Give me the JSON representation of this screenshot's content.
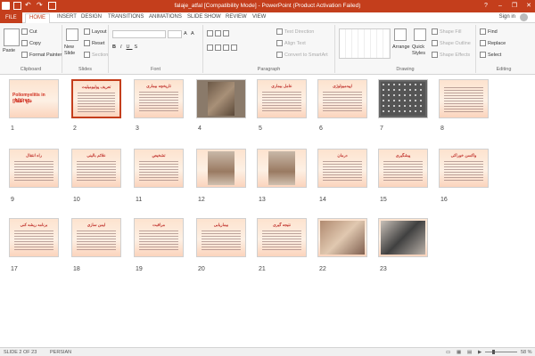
{
  "titlebar": {
    "title": "falaje_atfal [Compatibility Mode] - PowerPoint (Product Activation Failed)",
    "help": "?",
    "min": "–",
    "restore": "❐",
    "close": "✕"
  },
  "tabs": {
    "file": "FILE",
    "home": "HOME",
    "insert": "INSERT",
    "design": "DESIGN",
    "transitions": "TRANSITIONS",
    "animations": "ANIMATIONS",
    "slideshow": "SLIDE SHOW",
    "review": "REVIEW",
    "view": "VIEW",
    "signin": "Sign in"
  },
  "ribbon": {
    "clipboard": {
      "paste": "Paste",
      "cut": "Cut",
      "copy": "Copy",
      "format_painter": "Format Painter",
      "label": "Clipboard"
    },
    "slides": {
      "new_slide": "New Slide",
      "layout": "Layout",
      "reset": "Reset",
      "section": "Section",
      "label": "Slides"
    },
    "font": {
      "label": "Font"
    },
    "paragraph": {
      "text_direction": "Text Direction",
      "align_text": "Align Text",
      "convert_smartart": "Convert to SmartArt",
      "label": "Paragraph"
    },
    "drawing": {
      "arrange": "Arrange",
      "quick_styles": "Quick Styles",
      "shape_fill": "Shape Fill",
      "shape_outline": "Shape Outline",
      "shape_effects": "Shape Effects",
      "label": "Drawing"
    },
    "editing": {
      "find": "Find",
      "replace": "Replace",
      "select": "Select",
      "label": "Editing"
    }
  },
  "slides": [
    {
      "num": "1",
      "title": "Poliomyelitis in children",
      "sub": "فلج اطفال"
    },
    {
      "num": "2",
      "title": "تعریف پولیومیلیت"
    },
    {
      "num": "3",
      "title": "تاریخچه بیماری"
    },
    {
      "num": "4",
      "title": ""
    },
    {
      "num": "5",
      "title": "عامل بیماری"
    },
    {
      "num": "6",
      "title": "اپیدمیولوژی"
    },
    {
      "num": "7",
      "title": ""
    },
    {
      "num": "8",
      "title": ""
    },
    {
      "num": "9",
      "title": "راه انتقال"
    },
    {
      "num": "10",
      "title": "علائم بالینی"
    },
    {
      "num": "11",
      "title": "تشخیص"
    },
    {
      "num": "12",
      "title": ""
    },
    {
      "num": "13",
      "title": ""
    },
    {
      "num": "14",
      "title": "درمان"
    },
    {
      "num": "15",
      "title": "پیشگیری"
    },
    {
      "num": "16",
      "title": "واکسن خوراکی"
    },
    {
      "num": "17",
      "title": "برنامه ریشه کنی"
    },
    {
      "num": "18",
      "title": "ایمن سازی"
    },
    {
      "num": "19",
      "title": "مراقبت"
    },
    {
      "num": "20",
      "title": "بیماریابی"
    },
    {
      "num": "21",
      "title": "نتیجه گیری"
    },
    {
      "num": "22",
      "title": ""
    },
    {
      "num": "23",
      "title": ""
    }
  ],
  "status": {
    "slide": "SLIDE 2 OF 23",
    "language": "PERSIAN",
    "zoom": "58 %",
    "zoom_percent": 58
  }
}
